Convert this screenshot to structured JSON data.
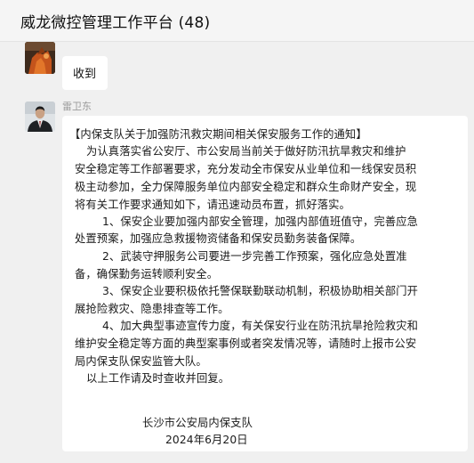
{
  "header": {
    "title": "威龙微控管理工作平台 (48)"
  },
  "message1": {
    "sender_name_partial": "……",
    "text": "收到"
  },
  "message2": {
    "sender_name": "雷卫东",
    "lines": [
      "【内保支队关于加强防汛救灾期间相关保安服务工作的通知】",
      "为认真落实省公安厅、市公安局当前关于做好防汛抗旱救灾和维护",
      "安全稳定等工作部署要求，充分发动全市保安从业单位和一线保安员积",
      "极主动参加，全力保障服务单位内部安全稳定和群众生命财产安全，现",
      "将有关工作要求通知如下，请迅速动员布置，抓好落实。",
      "1、保安企业要加强内部安全管理，加强内部值班值守，完善应急",
      "处置预案，加强应急救援物资储备和保安员勤务装备保障。",
      "2、武装守押服务公司要进一步完善工作预案，强化应急处置准",
      "备，确保勤务运转顺利安全。",
      "3、保安企业要积极依托警保联勤联动机制，积极协助相关部门开",
      "展抢险救灾、隐患排查等工作。",
      "4、加大典型事迹宣传力度，有关保安行业在防汛抗旱抢险救灾和",
      "维护安全稳定等方面的典型案事例或者突发情况等，请随时上报市公安",
      "局内保支队保安监管大队。",
      "以上工作请及时查收并回复。",
      "长沙市公安局内保支队",
      "2024年6月20日"
    ]
  }
}
